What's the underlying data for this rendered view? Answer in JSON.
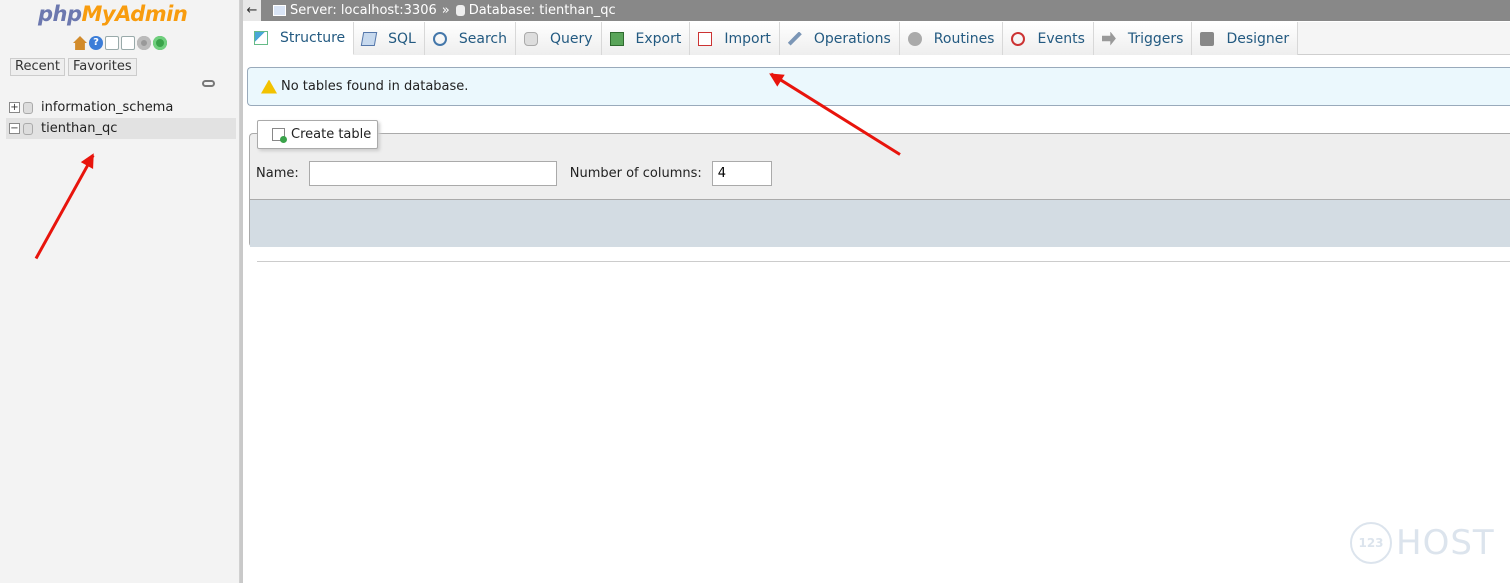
{
  "sidebar": {
    "logo_php": "php",
    "logo_rest": "MyAdmin",
    "recent_label": "Recent",
    "favorites_label": "Favorites",
    "databases": [
      {
        "name": "information_schema",
        "expander": "+"
      },
      {
        "name": "tienthan_qc",
        "expander": "−"
      }
    ]
  },
  "breadcrumb": {
    "back": "←",
    "server": "Server: localhost:3306",
    "separator": "»",
    "database": "Database: tienthan_qc"
  },
  "tabs": [
    {
      "label": "Structure",
      "icon": "structure-icon",
      "active": true
    },
    {
      "label": "SQL",
      "icon": "sql-icon"
    },
    {
      "label": "Search",
      "icon": "search-icon"
    },
    {
      "label": "Query",
      "icon": "query-icon"
    },
    {
      "label": "Export",
      "icon": "export-icon"
    },
    {
      "label": "Import",
      "icon": "import-icon"
    },
    {
      "label": "Operations",
      "icon": "wrench-icon"
    },
    {
      "label": "Routines",
      "icon": "routines-icon"
    },
    {
      "label": "Events",
      "icon": "clock-icon"
    },
    {
      "label": "Triggers",
      "icon": "triggers-icon"
    },
    {
      "label": "Designer",
      "icon": "designer-icon"
    }
  ],
  "notice": {
    "text": "No tables found in database."
  },
  "create_table": {
    "legend": "Create table",
    "name_label": "Name:",
    "name_value": "",
    "columns_label": "Number of columns:",
    "columns_value": "4"
  },
  "watermark": {
    "badge": "123",
    "text": "HOST"
  },
  "colors": {
    "annotation_arrow": "#e8140c",
    "logo_php": "#6c78af",
    "logo_myadmin": "#f89c0e",
    "tab_text": "#235a81"
  }
}
